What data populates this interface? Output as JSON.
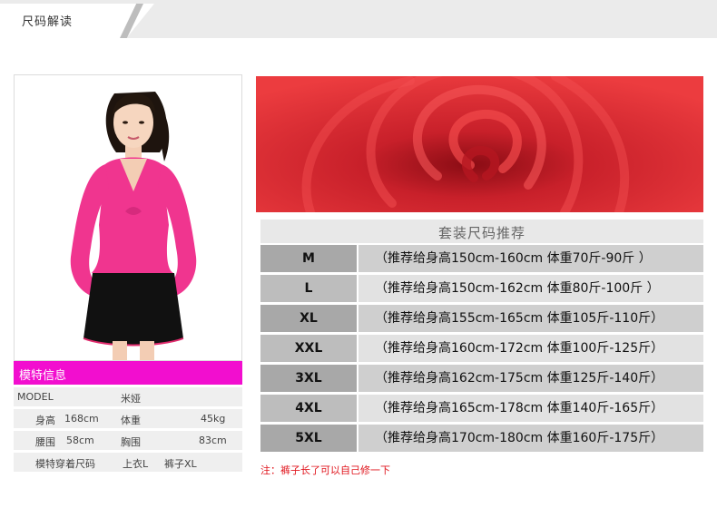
{
  "header": {
    "title": "尺码解读"
  },
  "model_info": {
    "title": "模特信息",
    "rows": [
      {
        "label": "MODEL",
        "value": "米娅"
      },
      {
        "label": "身高",
        "value": "168cm",
        "label2": "体重",
        "value2": "45kg"
      },
      {
        "label": "腰围",
        "value": "58cm",
        "label2": "胸围",
        "value2": "83cm"
      },
      {
        "label": "模特穿着尺码",
        "value": "上衣L",
        "value2": "裤子XL"
      }
    ]
  },
  "size_chart": {
    "title": "套装尺码推荐",
    "rows": [
      {
        "size": "M",
        "recommendation": "（推荐给身高150cm-160cm 体重70斤-90斤  ）"
      },
      {
        "size": "L",
        "recommendation": "（推荐给身高150cm-162cm 体重80斤-100斤 ）"
      },
      {
        "size": "XL",
        "recommendation": "（推荐给身高155cm-165cm 体重105斤-110斤）"
      },
      {
        "size": "XXL",
        "recommendation": "（推荐给身高160cm-172cm 体重100斤-125斤）"
      },
      {
        "size": "3XL",
        "recommendation": "（推荐给身高162cm-175cm 体重125斤-140斤）"
      },
      {
        "size": "4XL",
        "recommendation": "（推荐给身高165cm-178cm 体重140斤-165斤）"
      },
      {
        "size": "5XL",
        "recommendation": "（推荐给身高170cm-180cm 体重160斤-175斤）"
      }
    ]
  },
  "note": "注：裤子长了可以自己修一下",
  "colors": {
    "accent": "#f20ecf",
    "shirt": "#f0358f",
    "fabric": "#e23338",
    "note": "#e0141c"
  }
}
